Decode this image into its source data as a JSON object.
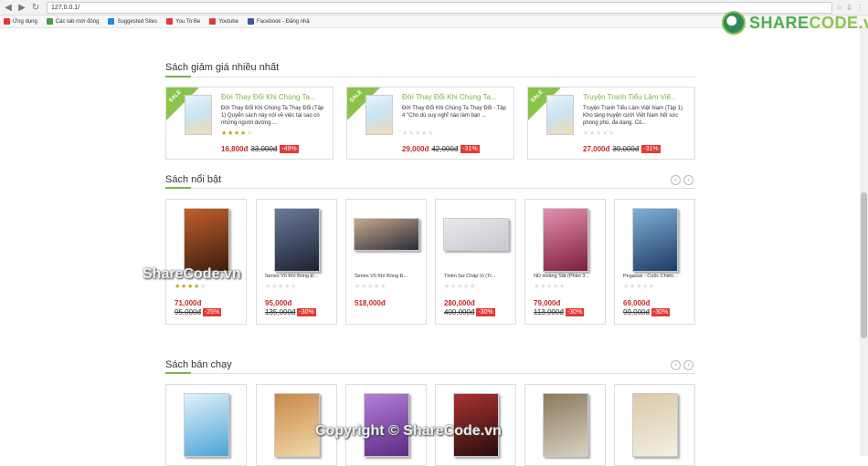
{
  "browser": {
    "url": "127.0.0.1/"
  },
  "bookmarks": [
    {
      "label": "Ứng dụng",
      "color": "#e53935"
    },
    {
      "label": "Các tab mới đóng",
      "color": "#43a047"
    },
    {
      "label": "Suggested Sites",
      "color": "#1e88e5"
    },
    {
      "label": "You To Be",
      "color": "#e53935"
    },
    {
      "label": "Youtube",
      "color": "#e53935"
    },
    {
      "label": "Facebook - Đăng nhậ",
      "color": "#3b5998"
    }
  ],
  "logo": {
    "text_a": "SHARE",
    "text_b": "CODE.vn"
  },
  "sections": {
    "sale": "Sách giảm giá nhiều nhất",
    "featured": "Sách nổi bật",
    "bestseller": "Sách bán chạy"
  },
  "sale_badge": "SALE",
  "sale_items": [
    {
      "name": "Đời Thay Đổi Khi Chúng Ta...",
      "desc": "Đời Thay Đổi Khi Chúng Ta Thay Đổi (Tập 1) Quyển sách này nói về việc tại sao có những người dường ...",
      "rating": 4,
      "price": "16,800đ",
      "old": "33,000đ",
      "discount": "-49%"
    },
    {
      "name": "Đời Thay Đổi Khi Chúng Ta...",
      "desc": "Đời Thay Đổi Khi Chúng Ta Thay Đổi - Tập 4 \"Cho dù suy nghĩ nào làm bạn ...",
      "rating": 0,
      "price": "29,000đ",
      "old": "42,000đ",
      "discount": "-31%"
    },
    {
      "name": "Truyện Tranh Tiểu Lâm Việ...",
      "desc": "Truyện Tranh Tiểu Lâm Việt Nam (Tập 1) Kho tàng truyện cười Việt Nam hết sức phong phú, đa dạng. Có...",
      "rating": 0,
      "price": "27,000đ",
      "old": "39,000đ",
      "discount": "-31%"
    }
  ],
  "featured_items": [
    {
      "name": "",
      "rating": 4,
      "price": "71,000đ",
      "old": "95,000đ",
      "discount": "-25%",
      "cover_a": "#3b1d0f",
      "cover_b": "#c2602b"
    },
    {
      "name": "Series Vũ Khí Bóng Đ...",
      "rating": 0,
      "price": "95,000đ",
      "old": "135,000đ",
      "discount": "-30%",
      "cover_a": "#1c2233",
      "cover_b": "#6b7a99"
    },
    {
      "name": "Series Vũ Khí Bóng Đ...",
      "rating": 0,
      "price": "518,000đ",
      "old": "",
      "discount": "",
      "cover_a": "#2a2a3a",
      "cover_b": "#c7a98a"
    },
    {
      "name": "Thiên Sứ Chấp Vị (Tr...",
      "rating": 0,
      "price": "280,000đ",
      "old": "400,000đ",
      "discount": "-30%",
      "cover_a": "#c8c8d0",
      "cover_b": "#e8e8ee"
    },
    {
      "name": "ND Hoàng Sắt (Phần 3...",
      "rating": 0,
      "price": "79,000đ",
      "old": "113,000đ",
      "discount": "-30%",
      "cover_a": "#7b1f3a",
      "cover_b": "#e58fb0"
    },
    {
      "name": "Pegasus - Cuộc Chiến...",
      "rating": 0,
      "price": "69,000đ",
      "old": "99,000đ",
      "discount": "-30%",
      "cover_a": "#1d3a66",
      "cover_b": "#7fb0d8"
    }
  ],
  "bestseller_items": [
    {
      "cover_a": "#4aa3d8",
      "cover_b": "#e3f1f8"
    },
    {
      "cover_a": "#f0d9a8",
      "cover_b": "#c9874a"
    },
    {
      "cover_a": "#5b2a83",
      "cover_b": "#b57fd9"
    },
    {
      "cover_a": "#2a0d0d",
      "cover_b": "#a8322f"
    },
    {
      "cover_a": "#d9d0bf",
      "cover_b": "#8a7a5f"
    },
    {
      "cover_a": "#f4efe3",
      "cover_b": "#d9c9a6"
    }
  ],
  "watermarks": {
    "mid": "ShareCode.vn",
    "bottom": "Copyright © ShareCode.vn"
  },
  "colors": {
    "accent": "#7cb342",
    "price": "#c62828",
    "discount": "#e53935"
  }
}
